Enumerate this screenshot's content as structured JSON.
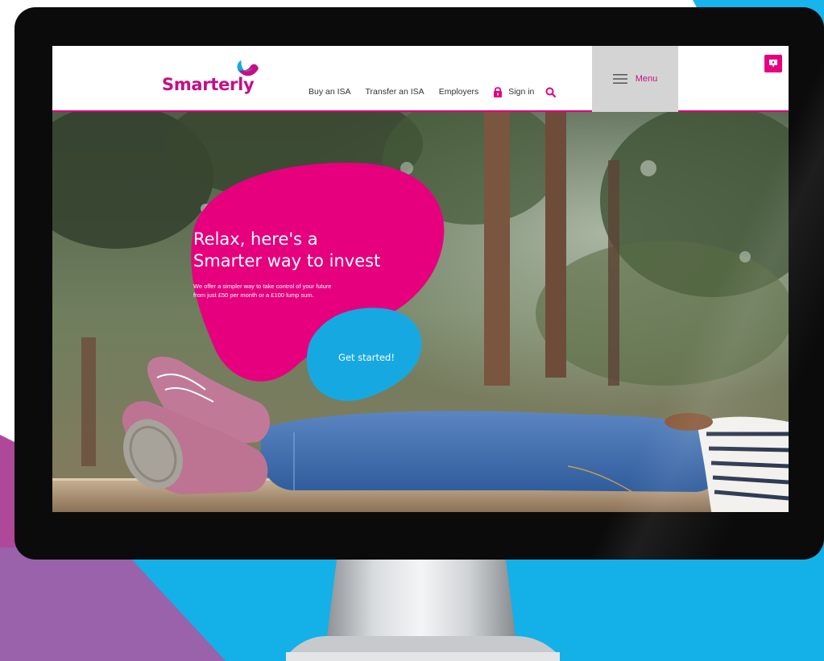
{
  "brand": {
    "name": "Smarterly",
    "pink": "#e6007e",
    "magenta": "#c40f86",
    "blue": "#16a9e1",
    "purple": "#8a5aa8"
  },
  "nav": {
    "items": [
      "Buy an ISA",
      "Transfer an ISA",
      "Employers"
    ],
    "sign_in": "Sign in",
    "menu_label": "Menu"
  },
  "hero": {
    "heading_line1": "Relax, here's a",
    "heading_line2": "Smarter way to invest",
    "subtext_line1": "We offer a simpler way to take control of your future",
    "subtext_line2": "from just £50 per month or a £100 lump sum.",
    "cta_label": "Get started!"
  },
  "icons": {
    "lock": "lock-icon",
    "search": "search-icon",
    "menu": "hamburger-icon",
    "chat": "chat-icon"
  }
}
